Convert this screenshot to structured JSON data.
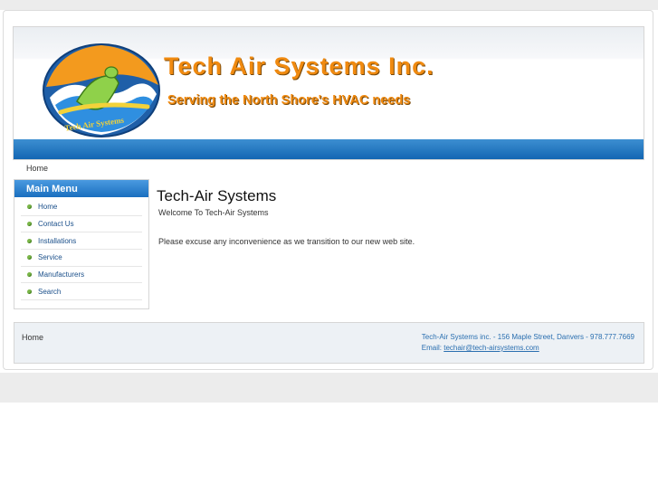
{
  "header": {
    "title": "Tech Air Systems Inc.",
    "tagline": "Serving the North Shore's HVAC needs",
    "logo_icon": "surfer-logo-icon",
    "logo_text": "Tech Air Systems"
  },
  "breadcrumb": "Home",
  "sidebar": {
    "heading": "Main Menu",
    "items": [
      "Home",
      "Contact Us",
      "Installations",
      "Service",
      "Manufacturers",
      "Search"
    ]
  },
  "main": {
    "title": "Tech-Air Systems",
    "welcome": "Welcome To Tech-Air Systems",
    "notice": "Please excuse any inconvenience as we transition to our new web site."
  },
  "footer": {
    "home_link": "Home",
    "address": "Tech-Air Systems inc. - 156 Maple Street, Danvers - 978.777.7669",
    "email_label": "Email:",
    "email": "techair@tech-airsystems.com"
  },
  "colors": {
    "accent_blue": "#1a6fbf",
    "title_orange": "#f08a10",
    "bullet_green": "#7ab648"
  }
}
